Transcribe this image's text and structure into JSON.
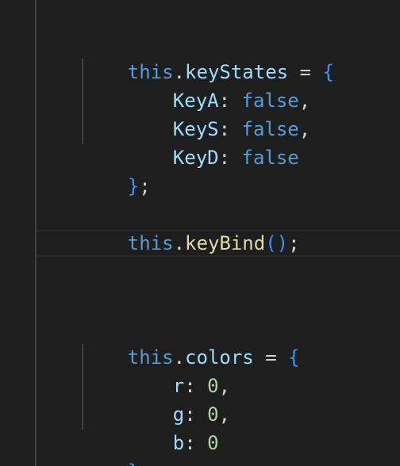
{
  "editor": {
    "keyword_this": "this",
    "dot": ".",
    "assign": " = ",
    "open_brace": "{",
    "close_brace": "}",
    "semicolon": ";",
    "colon": ":",
    "comma": ",",
    "bool_false": "false",
    "key_states_prop": "keyStates",
    "key_a": "KeyA",
    "key_s": "KeyS",
    "key_d": "KeyD",
    "key_bind_fn": "keyBind",
    "call_parens": "()",
    "colors_prop": "colors",
    "color_r": "r",
    "color_g": "g",
    "color_b": "b",
    "zero": "0"
  },
  "colors": {
    "background": "#1e1e1e",
    "keyword": "#569cd6",
    "property": "#9cdcfe",
    "function": "#dcdcaa",
    "number": "#b5cea8",
    "punctuation": "#d4d4d4",
    "bracket": "#3794ff"
  }
}
